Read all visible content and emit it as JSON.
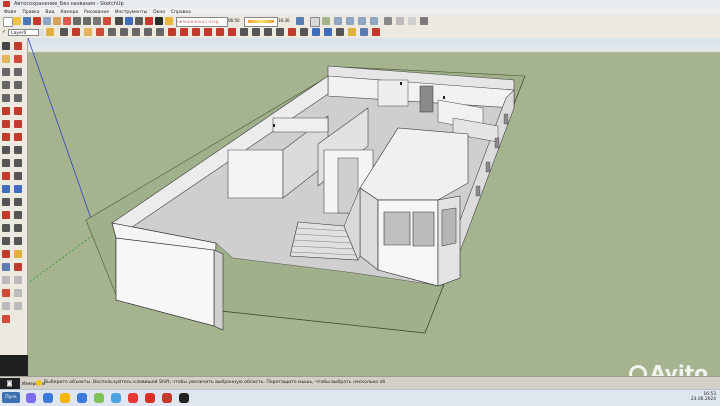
{
  "window": {
    "title": "Автосохранение_Без названия - SketchUp"
  },
  "menu": {
    "items": [
      "Файл",
      "Правка",
      "Вид",
      "Камера",
      "Рисование",
      "Инструменты",
      "Окно",
      "Справка"
    ]
  },
  "toolbar": {
    "sun_scale": "I Ф М А М И И А С О Н Д",
    "time_value": "06:50",
    "time_end": "16:30"
  },
  "layers": {
    "current": "Layer0"
  },
  "status": {
    "measure_label": "Измерения",
    "hint": "Выберите объекты. Воспользуйтесь клавишей Shift, чтобы увеличить выбранную область. Перетащите мышь, чтобы выбрать несколько об"
  },
  "taskbar": {
    "start_label": "Пуск",
    "time": "16:53",
    "date": "23.06.2024"
  },
  "watermark": {
    "text": "Avito"
  },
  "colors": {
    "sky": "#dbe3ea",
    "ground": "#a5b48f",
    "wall": "#f4f4f4",
    "wall_shade": "#d9d9d9",
    "floor": "#c9c9c9",
    "accent_red": "#c23a2b"
  }
}
